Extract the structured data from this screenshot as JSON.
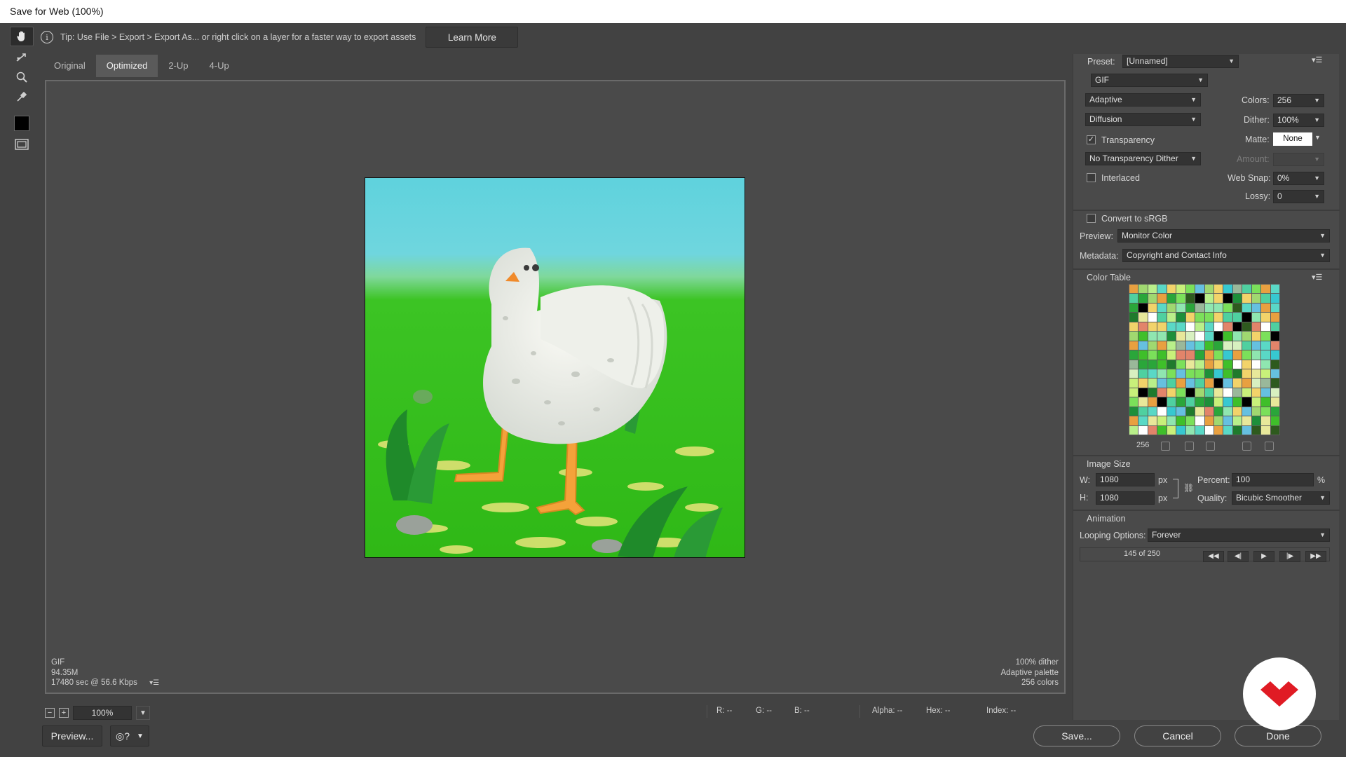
{
  "window": {
    "title": "Save for Web (100%)"
  },
  "tip": {
    "text": "Tip: Use File > Export > Export As...  or right click on a layer for a faster way to export assets",
    "learn_more": "Learn More"
  },
  "tools": [
    "hand-tool",
    "slice-select-tool",
    "zoom-tool",
    "eyedropper-tool",
    "eyedropper-color",
    "toggle-slices"
  ],
  "tabs": [
    {
      "label": "Original",
      "active": false
    },
    {
      "label": "Optimized",
      "active": true
    },
    {
      "label": "2-Up",
      "active": false
    },
    {
      "label": "4-Up",
      "active": false
    }
  ],
  "image_info": {
    "format": "GIF",
    "size": "94.35M",
    "time": "17480 sec @ 56.6 Kbps",
    "dither": "100% dither",
    "palette": "Adaptive palette",
    "colors": "256 colors"
  },
  "zoom": {
    "value": "100%"
  },
  "readouts": {
    "r": "R: --",
    "g": "G: --",
    "b": "B: --",
    "alpha": "Alpha: --",
    "hex": "Hex: --",
    "index": "Index: --"
  },
  "buttons": {
    "preview": "Preview...",
    "save": "Save...",
    "cancel": "Cancel",
    "done": "Done"
  },
  "settings": {
    "preset_label": "Preset:",
    "preset_value": "[Unnamed]",
    "format": "GIF",
    "reduction": "Adaptive",
    "dither_algo": "Diffusion",
    "colors_label": "Colors:",
    "colors_value": "256",
    "dither_label": "Dither:",
    "dither_value": "100%",
    "transparency_label": "Transparency",
    "transparency_checked": true,
    "matte_label": "Matte:",
    "matte_value": "None",
    "transparency_dither": "No Transparency Dither",
    "amount_label": "Amount:",
    "interlaced_label": "Interlaced",
    "interlaced_checked": false,
    "websnap_label": "Web Snap:",
    "websnap_value": "0%",
    "lossy_label": "Lossy:",
    "lossy_value": "0",
    "convert_srgb_label": "Convert to sRGB",
    "convert_srgb_checked": false,
    "preview_label": "Preview:",
    "preview_value": "Monitor Color",
    "metadata_label": "Metadata:",
    "metadata_value": "Copyright and Contact Info"
  },
  "color_table": {
    "title": "Color Table",
    "count": "256"
  },
  "image_size": {
    "title": "Image Size",
    "w_label": "W:",
    "w_value": "1080",
    "h_label": "H:",
    "h_value": "1080",
    "unit": "px",
    "percent_label": "Percent:",
    "percent_value": "100",
    "percent_unit": "%",
    "quality_label": "Quality:",
    "quality_value": "Bicubic Smoother"
  },
  "animation": {
    "title": "Animation",
    "looping_label": "Looping Options:",
    "looping_value": "Forever",
    "frame": "145 of 250"
  },
  "colors": {
    "sky": "#5fd2dd",
    "grass": "#35c21f",
    "accent_logo": "#e01b24"
  }
}
